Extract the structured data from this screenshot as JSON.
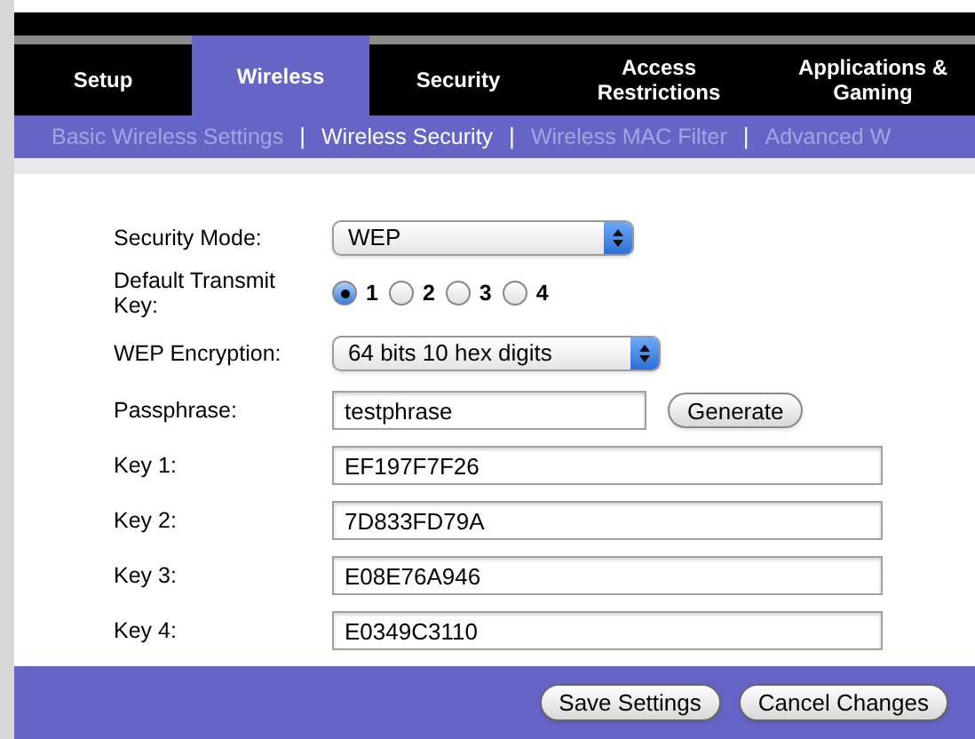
{
  "tabs": [
    {
      "label": "Setup",
      "selected": false
    },
    {
      "label": "Wireless",
      "selected": true
    },
    {
      "label": "Security",
      "selected": false
    },
    {
      "label": "Access Restrictions",
      "selected": false
    },
    {
      "label": "Applications & Gaming",
      "selected": false
    }
  ],
  "subtabs": [
    {
      "label": "Basic Wireless Settings",
      "selected": false
    },
    {
      "label": "|"
    },
    {
      "label": "Wireless Security",
      "selected": true
    },
    {
      "label": "|"
    },
    {
      "label": "Wireless MAC Filter",
      "selected": false
    },
    {
      "label": "|"
    },
    {
      "label": "Advanced W",
      "selected": false
    }
  ],
  "form": {
    "security_mode": {
      "label": "Security Mode:",
      "value": "WEP"
    },
    "transmit_key": {
      "label": "Default Transmit Key:",
      "options": [
        {
          "label": "1",
          "selected": true
        },
        {
          "label": "2",
          "selected": false
        },
        {
          "label": "3",
          "selected": false
        },
        {
          "label": "4",
          "selected": false
        }
      ]
    },
    "encryption": {
      "label": "WEP Encryption:",
      "value": "64 bits 10 hex digits"
    },
    "passphrase": {
      "label": "Passphrase:",
      "value": "testphrase",
      "button": "Generate"
    },
    "keys": [
      {
        "label": "Key 1:",
        "value": "EF197F7F26"
      },
      {
        "label": "Key 2:",
        "value": "7D833FD79A"
      },
      {
        "label": "Key 3:",
        "value": "E08E76A946"
      },
      {
        "label": "Key 4:",
        "value": "E0349C3110"
      }
    ]
  },
  "buttons": [
    "Save Settings",
    "Cancel Changes"
  ]
}
